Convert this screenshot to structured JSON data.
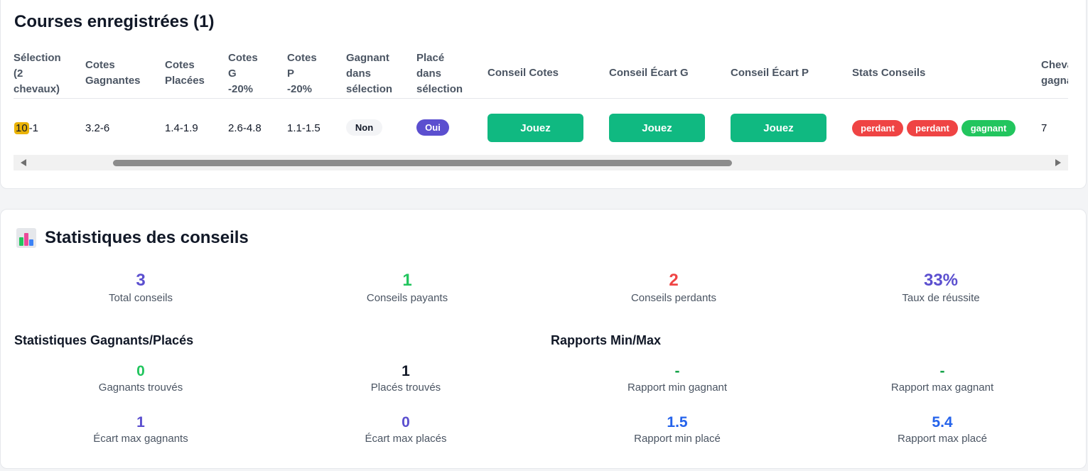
{
  "courses": {
    "title": "Courses enregistrées (1)",
    "headers": {
      "selection": [
        "Sélection",
        "(2",
        "chevaux)"
      ],
      "cotes_gagnantes": [
        "Cotes",
        "Gagnantes"
      ],
      "cotes_placees": [
        "Cotes",
        "Placées"
      ],
      "cotes_g": [
        "Cotes",
        "G",
        "-20%"
      ],
      "cotes_p": [
        "Cotes",
        "P",
        "-20%"
      ],
      "gagnant_sel": [
        "Gagnant",
        "dans",
        "sélection"
      ],
      "place_sel": [
        "Placé",
        "dans",
        "sélection"
      ],
      "conseil_cotes": "Conseil Cotes",
      "conseil_ecart_g": "Conseil Écart G",
      "conseil_ecart_p": "Conseil Écart P",
      "stats_conseils": "Stats Conseils",
      "chevaux_gagnants": [
        "Chevaux",
        "gagnants"
      ]
    },
    "row": {
      "selection_hl": "10",
      "selection_rest": "-1",
      "cotes_gagnantes": "3.2-6",
      "cotes_placees": "1.4-1.9",
      "cotes_g": "2.6-4.8",
      "cotes_p": "1.1-1.5",
      "gagnant_sel": "Non",
      "place_sel": "Oui",
      "conseil_cotes": "Jouez",
      "conseil_ecart_g": "Jouez",
      "conseil_ecart_p": "Jouez",
      "stats": [
        "perdant",
        "perdant",
        "gagnant"
      ],
      "chevaux_gagnants": "7"
    }
  },
  "stats": {
    "title": "Statistiques des conseils",
    "summary": [
      {
        "value": "3",
        "label": "Total conseils",
        "color": "#5b4fcf"
      },
      {
        "value": "1",
        "label": "Conseils payants",
        "color": "#22c55e"
      },
      {
        "value": "2",
        "label": "Conseils perdants",
        "color": "#ef4444"
      },
      {
        "value": "33%",
        "label": "Taux de réussite",
        "color": "#5b4fcf"
      }
    ],
    "gagnants_places": {
      "title": "Statistiques Gagnants/Placés",
      "items": [
        {
          "value": "0",
          "label": "Gagnants trouvés"
        },
        {
          "value": "1",
          "label": "Placés trouvés"
        },
        {
          "value": "1",
          "label": "Écart max gagnants"
        },
        {
          "value": "0",
          "label": "Écart max placés"
        }
      ]
    },
    "rapports": {
      "title": "Rapports Min/Max",
      "items": [
        {
          "value": "-",
          "label": "Rapport min gagnant"
        },
        {
          "value": "-",
          "label": "Rapport max gagnant"
        },
        {
          "value": "1.5",
          "label": "Rapport min placé"
        },
        {
          "value": "5.4",
          "label": "Rapport max placé"
        }
      ]
    }
  }
}
